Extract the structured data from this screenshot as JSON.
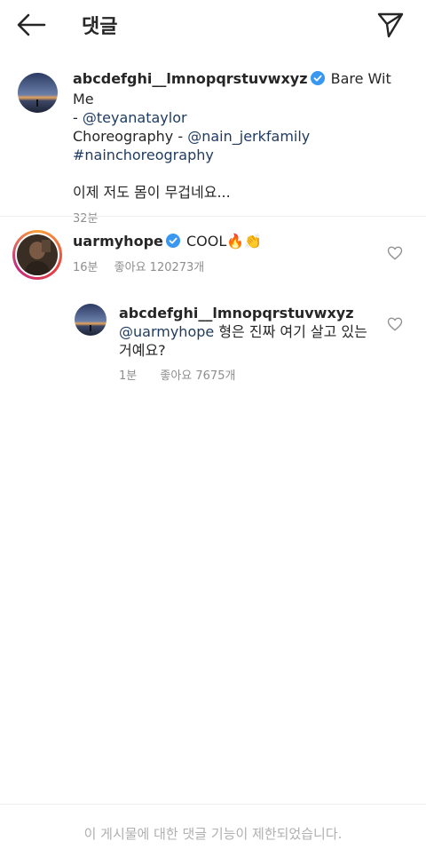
{
  "header": {
    "title": "댓글",
    "back_icon": "arrow-left-icon",
    "send_icon": "paper-plane-icon"
  },
  "caption": {
    "username": "abcdefghi__lmnopqrstuvwxyz",
    "text_1": "Bare Wit Me",
    "dash_1": "- ",
    "mention_1": "@teyanataylor",
    "text_2": "Choreography - ",
    "mention_2": "@nain_jerkfamily",
    "hashtag": "#nainchoreography",
    "text_3": "이제 저도 몸이 무겁네요...",
    "time": "32분"
  },
  "comment": {
    "username": "uarmyhope",
    "text": "COOL",
    "emojis": "🔥👏",
    "time": "16분",
    "likes": "좋아요 120273개"
  },
  "reply": {
    "username": "abcdefghi__lmnopqrstuvwxyz",
    "mention": "@uarmyhope",
    "text": " 형은 진짜 여기 살고 있는 거예요?",
    "time": "1분",
    "likes": "좋아요 7675개"
  },
  "footer": {
    "notice": "이 게시물에 대한 댓글 기능이 제한되었습니다."
  },
  "colors": {
    "verified": "#3897f0",
    "link": "#1e3a5f",
    "meta": "#8e8e8e",
    "footer_text": "#b0b0b0"
  }
}
